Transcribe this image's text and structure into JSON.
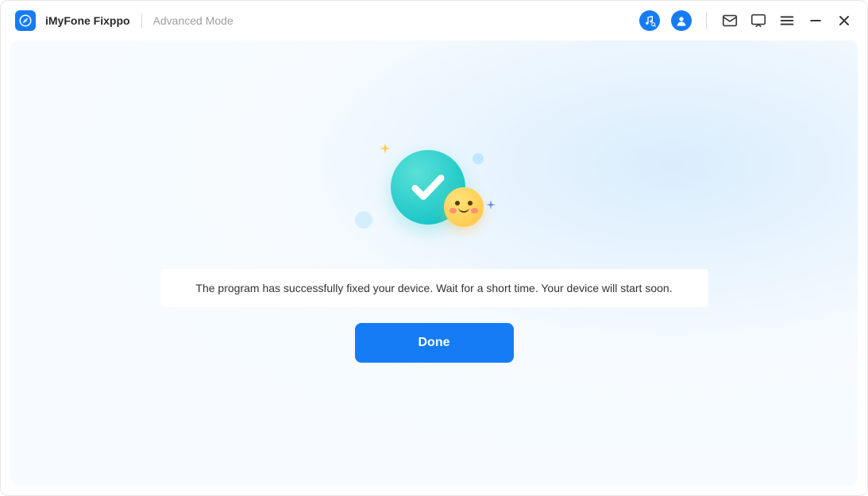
{
  "header": {
    "app_title": "iMyFone Fixppo",
    "mode_label": "Advanced Mode",
    "icons": {
      "music": "music-search-icon",
      "account": "account-icon",
      "mail": "mail-icon",
      "feedback": "feedback-icon",
      "menu": "menu-icon",
      "minimize": "minimize-icon",
      "close": "close-icon"
    }
  },
  "main": {
    "success_message": "The program has successfully fixed your device. Wait for a short time. Your device will start soon.",
    "done_label": "Done"
  },
  "colors": {
    "accent": "#167cf5"
  }
}
